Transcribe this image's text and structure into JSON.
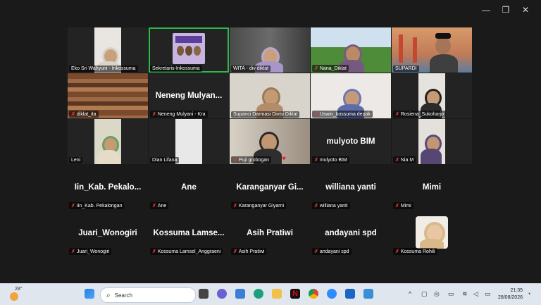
{
  "window": {
    "minimize": "—",
    "maximize": "❐",
    "close": "✕"
  },
  "video_tiles": [
    {
      "name": "Eko Sri Wahyuni - Inkossuma",
      "muted": false
    },
    {
      "name": "Sekretaris-Inkossuma",
      "muted": false,
      "active": true
    },
    {
      "name": "WITA - div diklat",
      "muted": false
    },
    {
      "name": "Nana_Diklat",
      "muted": true
    },
    {
      "name": "SUPARDI",
      "muted": false
    },
    {
      "name": "diklat_ita",
      "muted": true
    },
    {
      "name": "Neneng Mulyani - Kra",
      "muted": true,
      "big_name": "Neneng  Mulyan..."
    },
    {
      "name": "Supanci Darmasi Divisi Diklat",
      "muted": false
    },
    {
      "name": "Uswin_kossuma depok",
      "muted": true
    },
    {
      "name": "Rosiena_Sukoharjo",
      "muted": true
    },
    {
      "name": "Leni",
      "muted": false
    },
    {
      "name": "Dian Lifana",
      "muted": false
    },
    {
      "name": "Puji grobogan",
      "muted": true
    },
    {
      "name": "mulyoto BIM",
      "muted": true,
      "big_name": "mulyoto BIM"
    },
    {
      "name": "Nia M",
      "muted": true
    }
  ],
  "name_tiles": [
    {
      "big_name": "Iin_Kab.  Pekalo...",
      "name": "Iin_Kab. Pekalongan"
    },
    {
      "big_name": "Ane",
      "name": "Ane"
    },
    {
      "big_name": "Karanganyar  Gi...",
      "name": "Karanganyar Giyarni"
    },
    {
      "big_name": "williana yanti",
      "name": "williana yanti"
    },
    {
      "big_name": "Mimi",
      "name": "Mimi"
    },
    {
      "big_name": "Juari_Wonogiri",
      "name": "Juari_Wonogiri"
    },
    {
      "big_name": "Kossuma  Lamse...",
      "name": "Kossuma Lamsel_Anggraeni"
    },
    {
      "big_name": "Asih Pratiwi",
      "name": "Asih Pratiwi"
    },
    {
      "big_name": "andayani spd",
      "name": "andayani spd"
    },
    {
      "big_name": "",
      "name": "Kossuma Rohili",
      "avatar": true
    }
  ],
  "taskbar": {
    "weather_temp": "28°",
    "search_placeholder": "Search",
    "time": "21:35",
    "date": "28/08/2026"
  }
}
